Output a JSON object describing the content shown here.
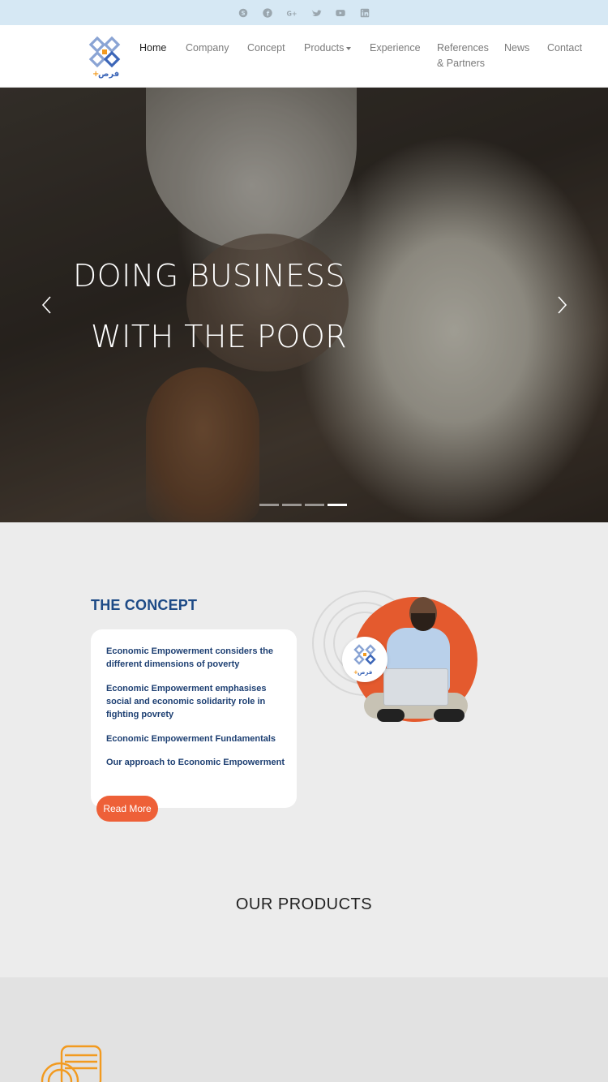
{
  "topbar": {
    "socials": [
      "skype-icon",
      "facebook-icon",
      "google-plus-icon",
      "twitter-icon",
      "youtube-icon",
      "linkedin-icon"
    ],
    "icon_color": "#9aa6ae"
  },
  "nav": {
    "items": [
      {
        "label": "Home"
      },
      {
        "label": "Company"
      },
      {
        "label": "Concept"
      },
      {
        "label": "Products"
      },
      {
        "label": "Experience"
      },
      {
        "label": "References"
      },
      {
        "label": "& Partners"
      },
      {
        "label": "News"
      },
      {
        "label": "Contact"
      }
    ]
  },
  "hero": {
    "line1": "DOING BUSINESS",
    "line2": "WITH THE POOR",
    "slides": 4,
    "active_slide": 4
  },
  "concept": {
    "title": "THE CONCEPT",
    "links": [
      {
        "text": "Economic Empowerment considers the different dimensions of poverty"
      },
      {
        "text": "Economic Empowerment emphasises social and economic solidarity role in fighting povrety"
      },
      {
        "text": "Economic Empowerment Fundamentals"
      },
      {
        "text": "Our approach to Economic Empowerment"
      }
    ],
    "read_more": "Read More"
  },
  "products": {
    "title": "OUR PRODUCTS"
  },
  "colors": {
    "brand_blue": "#1d4a86",
    "accent_orange": "#ee6038",
    "topbar_bg": "#d6e8f4"
  }
}
